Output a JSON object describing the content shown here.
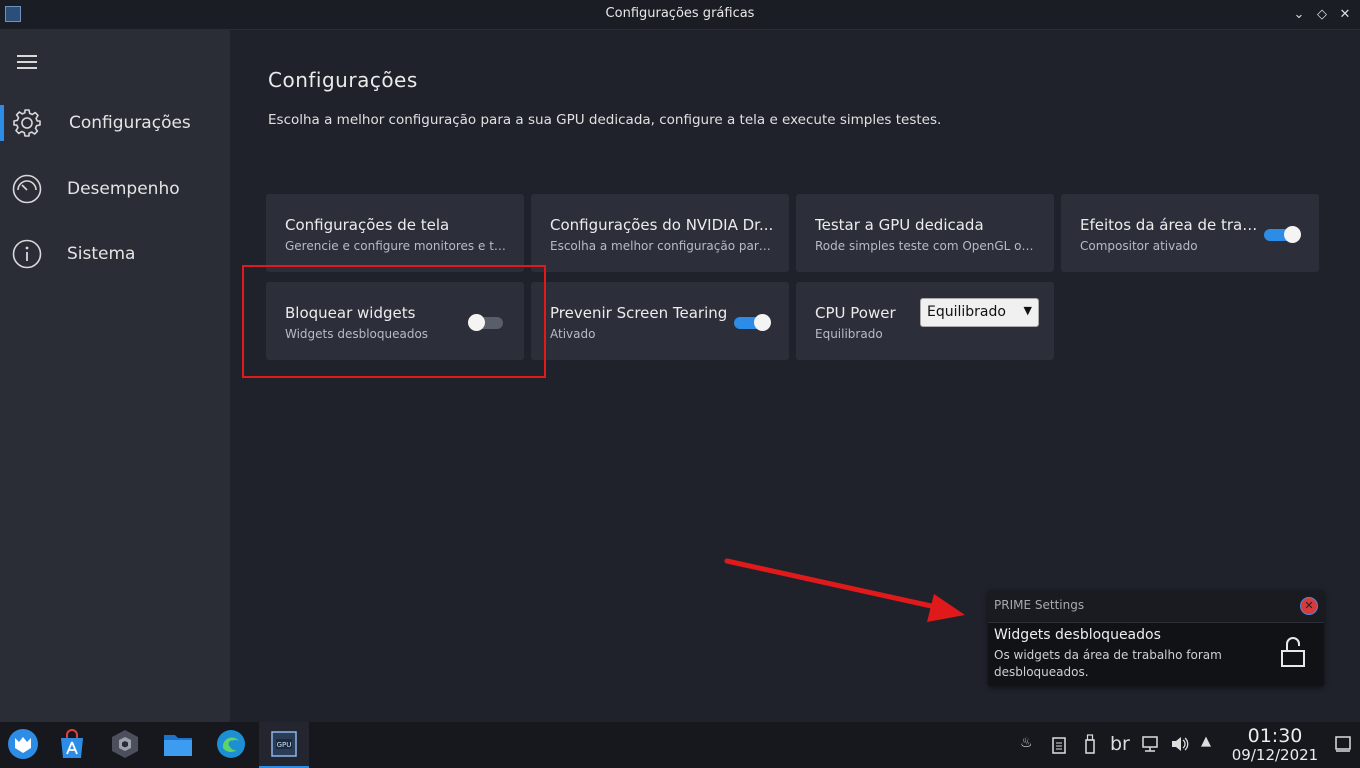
{
  "window": {
    "title": "Configurações gráficas"
  },
  "sidebar": {
    "items": [
      {
        "label": "Configurações",
        "icon": "gear-icon",
        "active": true
      },
      {
        "label": "Desempenho",
        "icon": "gauge-icon",
        "active": false
      },
      {
        "label": "Sistema",
        "icon": "info-icon",
        "active": false
      }
    ]
  },
  "main": {
    "heading": "Configurações",
    "description": "Escolha a melhor configuração para a sua GPU dedicada, configure a tela e execute simples testes.",
    "cards": [
      {
        "title": "Configurações de tela",
        "subtitle": "Gerencie e configure monitores e tel..."
      },
      {
        "title": "Configurações do NVIDIA Dr...",
        "subtitle": "Escolha a melhor configuração para ..."
      },
      {
        "title": "Testar a GPU dedicada",
        "subtitle": "Rode simples teste com OpenGL ou..."
      },
      {
        "title": "Efeitos da área de traba...",
        "subtitle": "Compositor ativado",
        "toggle": true
      },
      {
        "title": "Bloquear widgets",
        "subtitle": "Widgets desbloqueados",
        "toggle": false
      },
      {
        "title": "Prevenir Screen Tearing",
        "subtitle": "Ativado",
        "toggle": true
      },
      {
        "title": "CPU Power",
        "subtitle": "Equilibrado",
        "select_value": "Equilibrado"
      }
    ]
  },
  "notification": {
    "app": "PRIME Settings",
    "title": "Widgets desbloqueados",
    "body": "Os widgets da área de trabalho foram desbloqueados.",
    "icon": "unlock-icon"
  },
  "taskbar": {
    "apps": [
      "launcher-icon",
      "store-icon",
      "gamecube-icon",
      "files-icon",
      "edge-icon",
      "gpu-settings-icon"
    ],
    "keyboard_layout": "br",
    "time": "01:30",
    "date": "09/12/2021"
  },
  "colors": {
    "accent": "#2d8ce6",
    "highlight": "#e01a1a"
  }
}
